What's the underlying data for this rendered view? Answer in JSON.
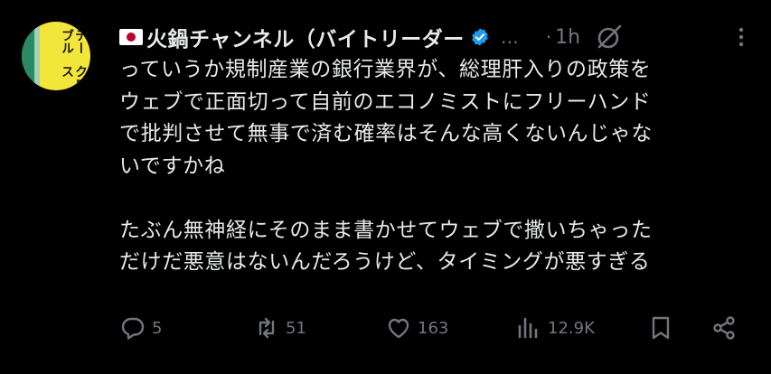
{
  "avatar": {
    "text_col1": "テーブル",
    "text_col2": "クロス"
  },
  "header": {
    "display_name": "火鍋チャンネル（バイトリーダー",
    "handle": "…",
    "separator": "·",
    "time": "1h"
  },
  "tweet": {
    "lines": [
      "っていうか規制産業の銀行業界が、総理肝入りの政策を",
      "ウェブで正面切って自前のエコノミストにフリーハンド",
      "で批判させて無事で済む確率はそんな高くないんじゃな",
      "いですかね",
      "",
      "たぶん無神経にそのまま書かせてウェブで撒いちゃった",
      "だけだ悪意はないんだろうけど、タイミングが悪すぎる"
    ]
  },
  "actions": {
    "replies": "5",
    "reposts": "51",
    "likes": "163",
    "views": "12.9K"
  },
  "colors": {
    "background": "#000000",
    "text": "#e7e9ea",
    "muted": "#71767b",
    "verified": "#1d9bf0",
    "flag_red": "#bc002d",
    "avatar_yellow": "#f3e63a"
  },
  "icons": [
    "japan-flag-icon",
    "verified-badge-icon",
    "grok-icon",
    "more-icon",
    "reply-icon",
    "repost-icon",
    "like-icon",
    "views-icon",
    "bookmark-icon",
    "share-icon"
  ]
}
